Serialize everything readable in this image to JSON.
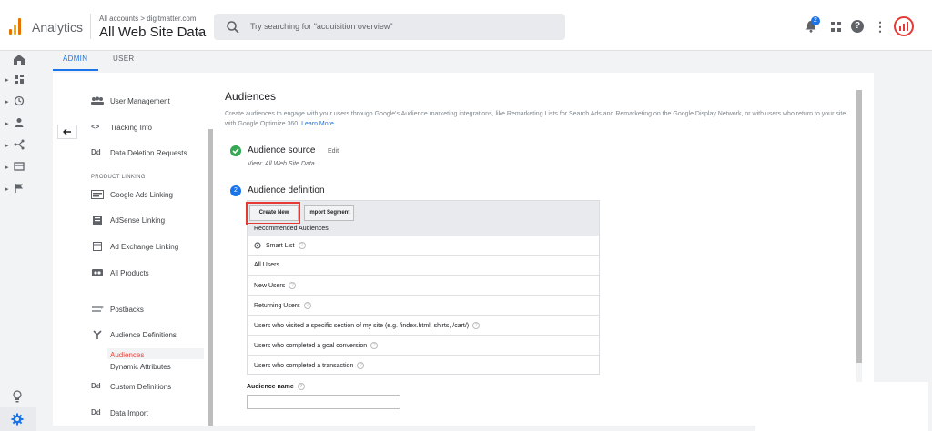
{
  "header": {
    "app_name": "Analytics",
    "breadcrumb": "All accounts > digitmatter.com",
    "view_name": "All Web Site Data",
    "search_placeholder": "Try searching for \"acquisition overview\"",
    "notification_count": "2"
  },
  "tabs": [
    {
      "label": "ADMIN",
      "active": true
    },
    {
      "label": "USER",
      "active": false
    }
  ],
  "left_nav": {
    "items": [
      {
        "label": "User Management",
        "icon": "users-icon"
      },
      {
        "label": "Tracking Info",
        "icon": "code-icon"
      },
      {
        "label": "Data Deletion Requests",
        "icon": "Dd"
      }
    ],
    "section_label": "PRODUCT LINKING",
    "product_items": [
      {
        "label": "Google Ads Linking",
        "icon": "google-ads-icon"
      },
      {
        "label": "AdSense Linking",
        "icon": "adsense-icon"
      },
      {
        "label": "Ad Exchange Linking",
        "icon": "ad-exchange-icon"
      },
      {
        "label": "All Products",
        "icon": "all-products-icon"
      },
      {
        "label": "Postbacks",
        "icon": "postbacks-icon"
      },
      {
        "label": "Audience Definitions",
        "icon": "audience-definitions-icon"
      }
    ],
    "sub_items": [
      {
        "label": "Audiences",
        "active": true
      },
      {
        "label": "Dynamic Attributes",
        "active": false
      }
    ],
    "bottom_items": [
      {
        "label": "Custom Definitions",
        "icon": "Dd"
      },
      {
        "label": "Data Import",
        "icon": "Dd"
      }
    ]
  },
  "content": {
    "title": "Audiences",
    "description": "Create audiences to engage with your users through Google's Audience marketing integrations, like Remarketing Lists for Search Ads and Remarketing on the Google Display Network, or with users who return to your site with Google Optimize 360.",
    "learn_more": "Learn More",
    "step1": {
      "title": "Audience source",
      "edit": "Edit",
      "view_label": "View:",
      "view_value": "All Web Site Data"
    },
    "step2": {
      "number": "2",
      "title": "Audience definition"
    },
    "buttons": {
      "create_new": "Create New",
      "import_segment": "Import Segment"
    },
    "recommended_header": "Recommended Audiences",
    "audiences": [
      {
        "label": "Smart List",
        "help": true,
        "icon": "smart-list-icon"
      },
      {
        "label": "All Users",
        "help": false
      },
      {
        "label": "New Users",
        "help": true
      },
      {
        "label": "Returning Users",
        "help": true
      },
      {
        "label": "Users who visited a specific section of my site (e.g. /index.html, shirts, /cart/)",
        "help": true
      },
      {
        "label": "Users who completed a goal conversion",
        "help": true
      },
      {
        "label": "Users who completed a transaction",
        "help": true
      }
    ],
    "audience_name_label": "Audience name",
    "audience_name_value": ""
  },
  "colors": {
    "brand_blue": "#1a73e8",
    "success_green": "#34a853",
    "highlight_red": "#e53935",
    "active_nav": "#e8453c"
  }
}
